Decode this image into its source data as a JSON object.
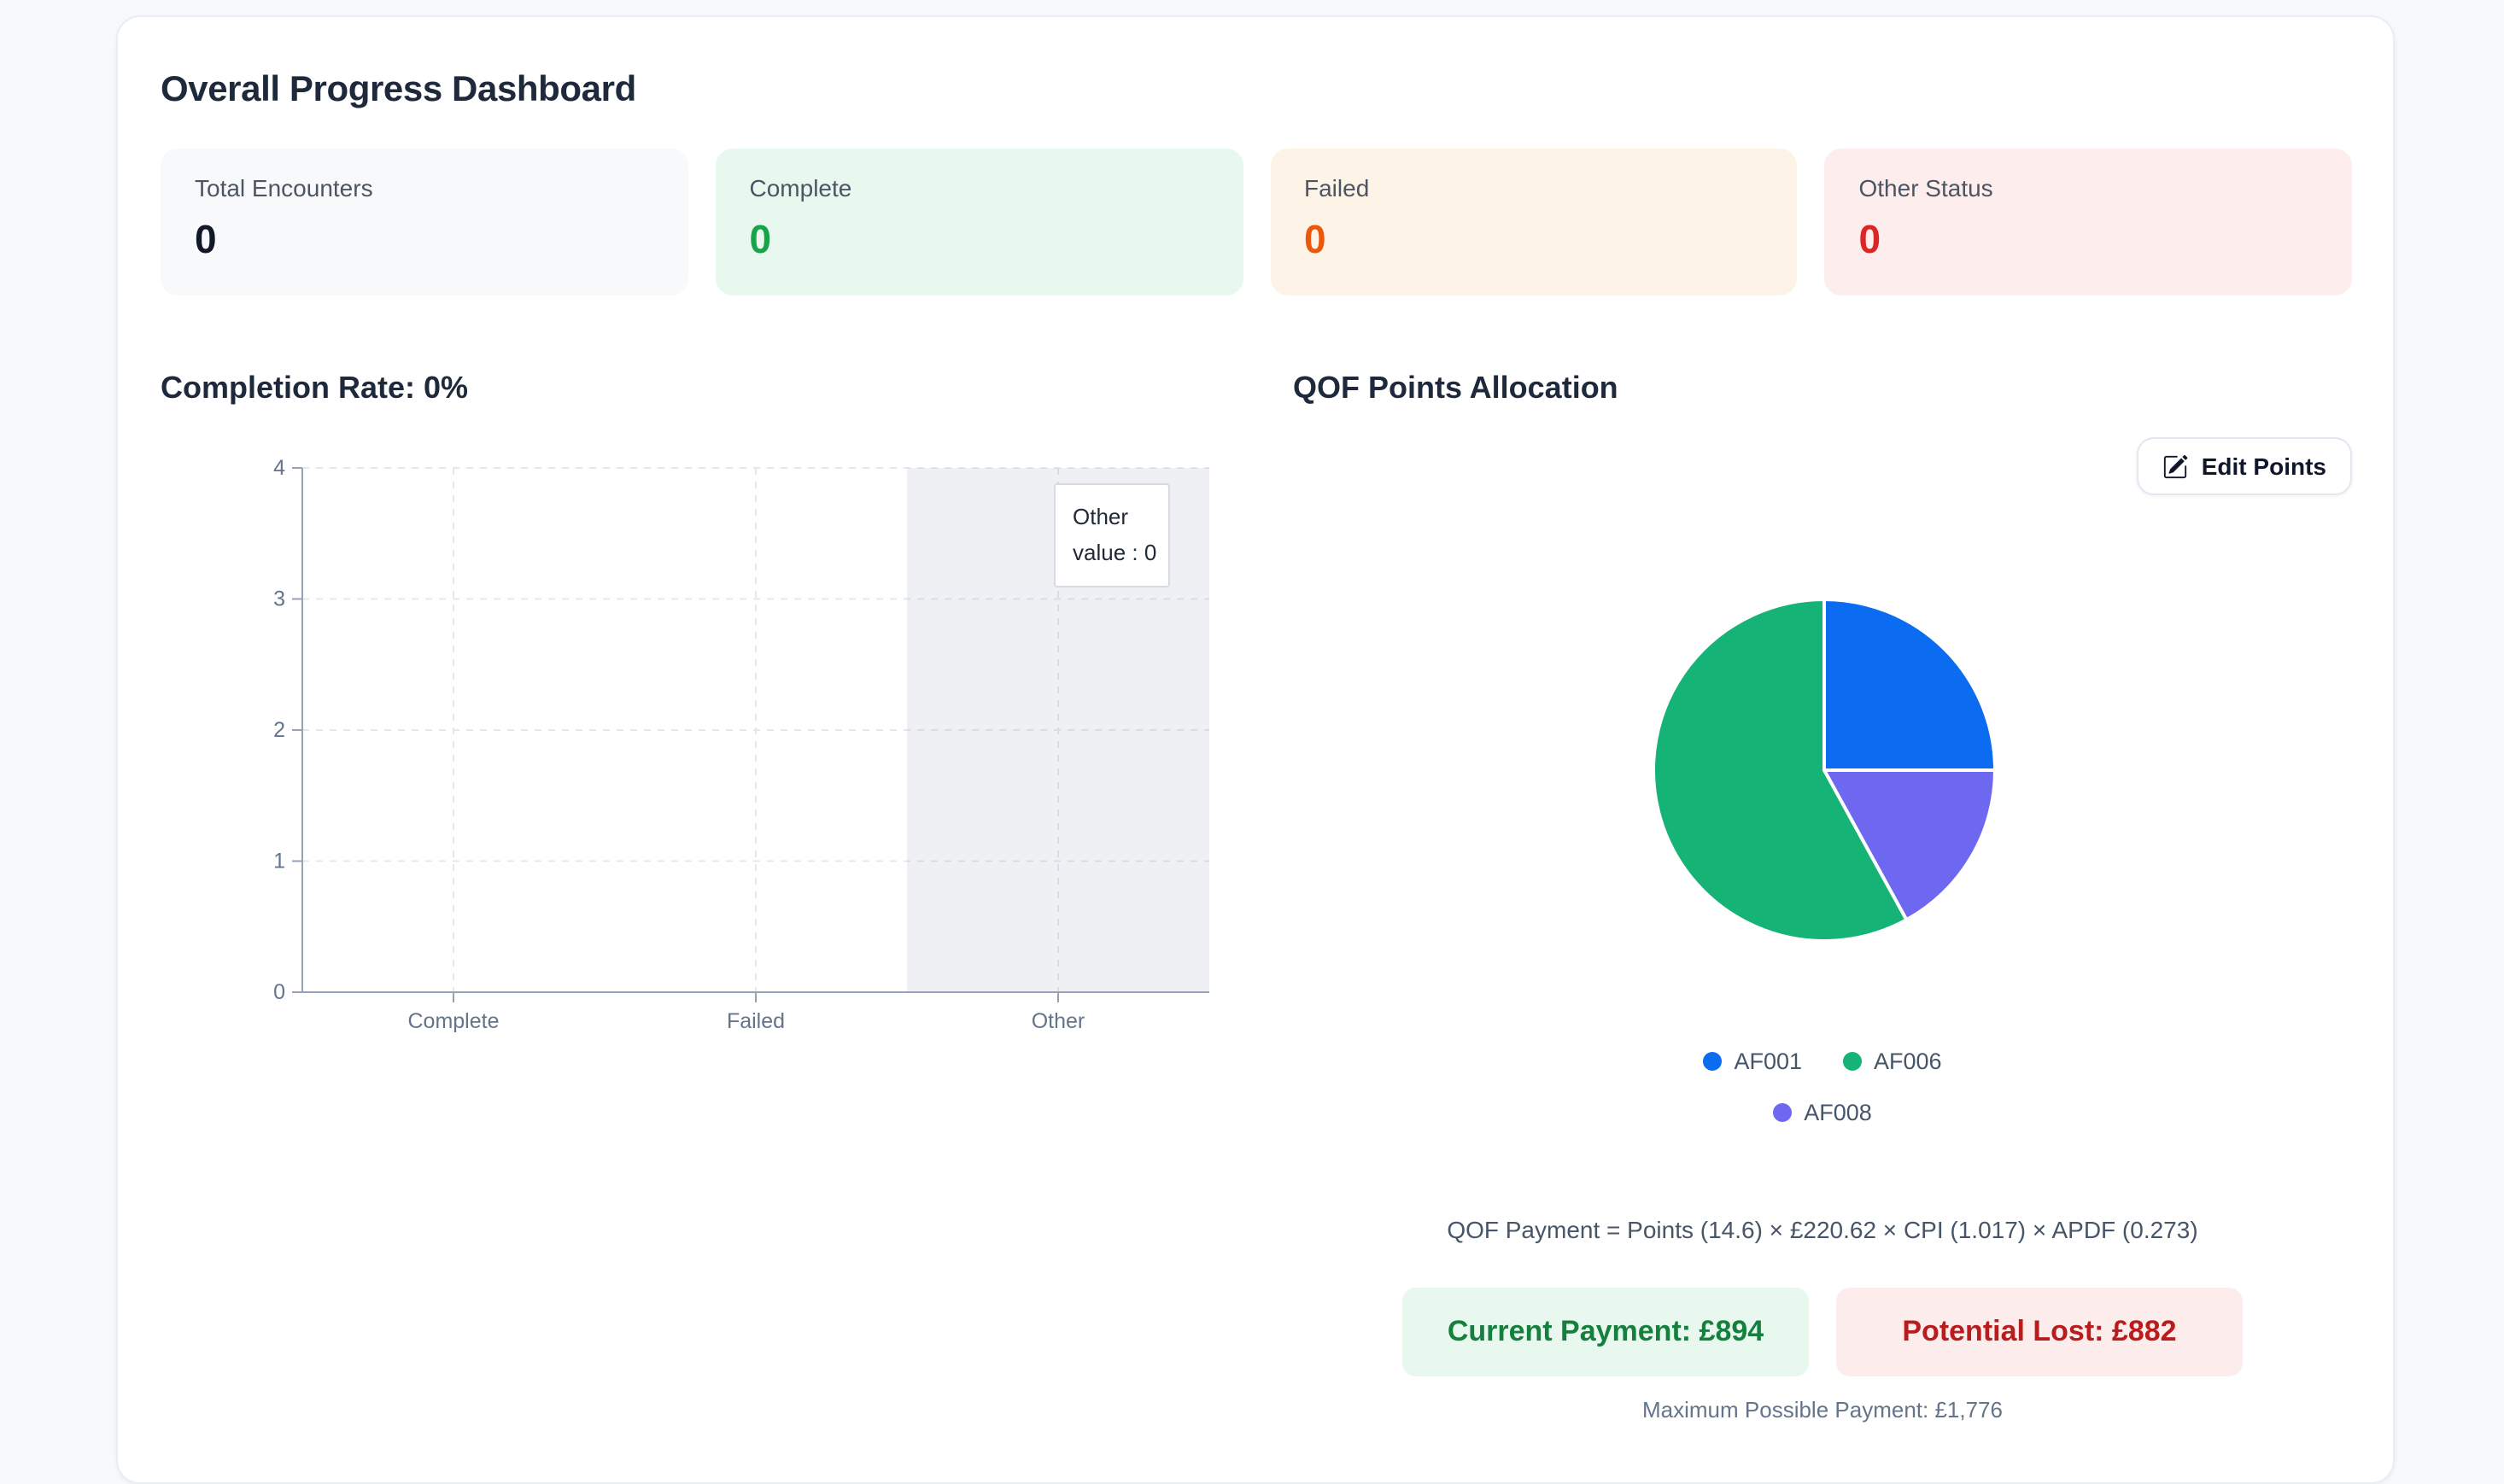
{
  "header": {
    "title": "Overall Progress Dashboard"
  },
  "stats": [
    {
      "label": "Total Encounters",
      "value": "0",
      "bg": "#f8f9fa",
      "color": "#111827"
    },
    {
      "label": "Complete",
      "value": "0",
      "bg": "#e9f8ef",
      "color": "#16a34a"
    },
    {
      "label": "Failed",
      "value": "0",
      "bg": "#fef3e7",
      "color": "#ea580c"
    },
    {
      "label": "Other Status",
      "value": "0",
      "bg": "#fdeded",
      "color": "#dc2626"
    }
  ],
  "completion": {
    "heading": "Completion Rate: 0%",
    "tooltip": {
      "title": "Other",
      "text": "value : 0"
    }
  },
  "qof": {
    "heading": "QOF Points Allocation",
    "edit_button_label": "Edit Points",
    "legend": [
      {
        "label": "AF001",
        "color": "#0b6cf2"
      },
      {
        "label": "AF006",
        "color": "#16b377"
      },
      {
        "label": "AF008",
        "color": "#6e68f0"
      }
    ],
    "formula": "QOF Payment = Points (14.6) × £220.62 × CPI (1.017) × APDF (0.273)",
    "current_payment": "Current Payment: £894",
    "potential_lost": "Potential Lost: £882",
    "max_payment": "Maximum Possible Payment: £1,776"
  },
  "chart_data": [
    {
      "type": "bar",
      "title": "Completion Rate: 0%",
      "categories": [
        "Complete",
        "Failed",
        "Other"
      ],
      "values": [
        0,
        0,
        0
      ],
      "ylim": [
        0,
        4
      ],
      "yticks": [
        0,
        1,
        2,
        3,
        4
      ],
      "grid": true,
      "grid_style": "dashed",
      "highlighted_category": "Other",
      "highlight_color": "rgba(148,163,184,0.16)",
      "axis_color": "#94a3b8",
      "tick_label_color": "#64748b",
      "tooltip": {
        "label": "Other",
        "value": 0
      }
    },
    {
      "type": "pie",
      "title": "QOF Points Allocation",
      "labels": [
        "AF001",
        "AF006",
        "AF008"
      ],
      "values_percent": [
        25,
        58,
        17
      ],
      "colors": [
        "#0b6cf2",
        "#16b377",
        "#6e68f0"
      ],
      "clockwise_order_from_top": [
        "AF001",
        "AF008",
        "AF006"
      ],
      "slice_border_color": "#ffffff",
      "legend_position": "bottom"
    }
  ]
}
